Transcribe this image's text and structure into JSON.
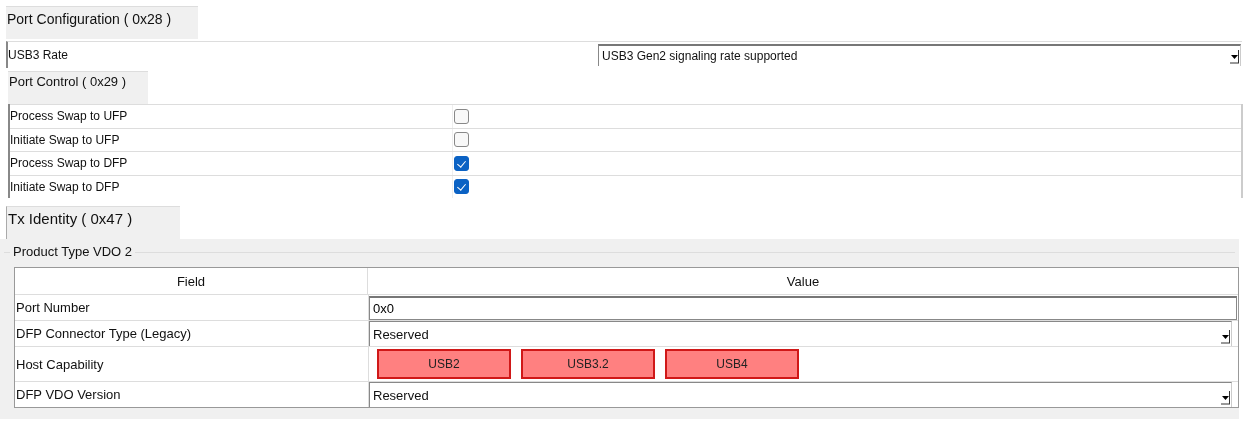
{
  "port_configuration": {
    "title": "Port Configuration  ( 0x28 )",
    "usb3_rate": {
      "label": "USB3 Rate",
      "value": "USB3 Gen2 signaling rate supported"
    }
  },
  "port_control": {
    "title": "Port Control  ( 0x29 )",
    "items": [
      {
        "label": "Process Swap to UFP",
        "checked": false
      },
      {
        "label": "Initiate Swap to UFP",
        "checked": false
      },
      {
        "label": "Process Swap to DFP",
        "checked": true
      },
      {
        "label": "Initiate Swap to DFP",
        "checked": true
      }
    ]
  },
  "tx_identity": {
    "title": "Tx Identity  ( 0x47 )",
    "group": "Product Type VDO 2",
    "table": {
      "columns": [
        "Field",
        "Value"
      ],
      "rows": [
        {
          "field": "Port Number",
          "kind": "text",
          "value": "0x0"
        },
        {
          "field": "DFP Connector Type (Legacy)",
          "kind": "dropdown",
          "value": "Reserved"
        },
        {
          "field": "Host Capability",
          "kind": "toggles",
          "options": [
            {
              "label": "USB2",
              "selected": false
            },
            {
              "label": "USB3.2",
              "selected": false
            },
            {
              "label": "USB4",
              "selected": false
            }
          ]
        },
        {
          "field": "DFP VDO Version",
          "kind": "dropdown",
          "value": "Reserved"
        }
      ]
    }
  }
}
